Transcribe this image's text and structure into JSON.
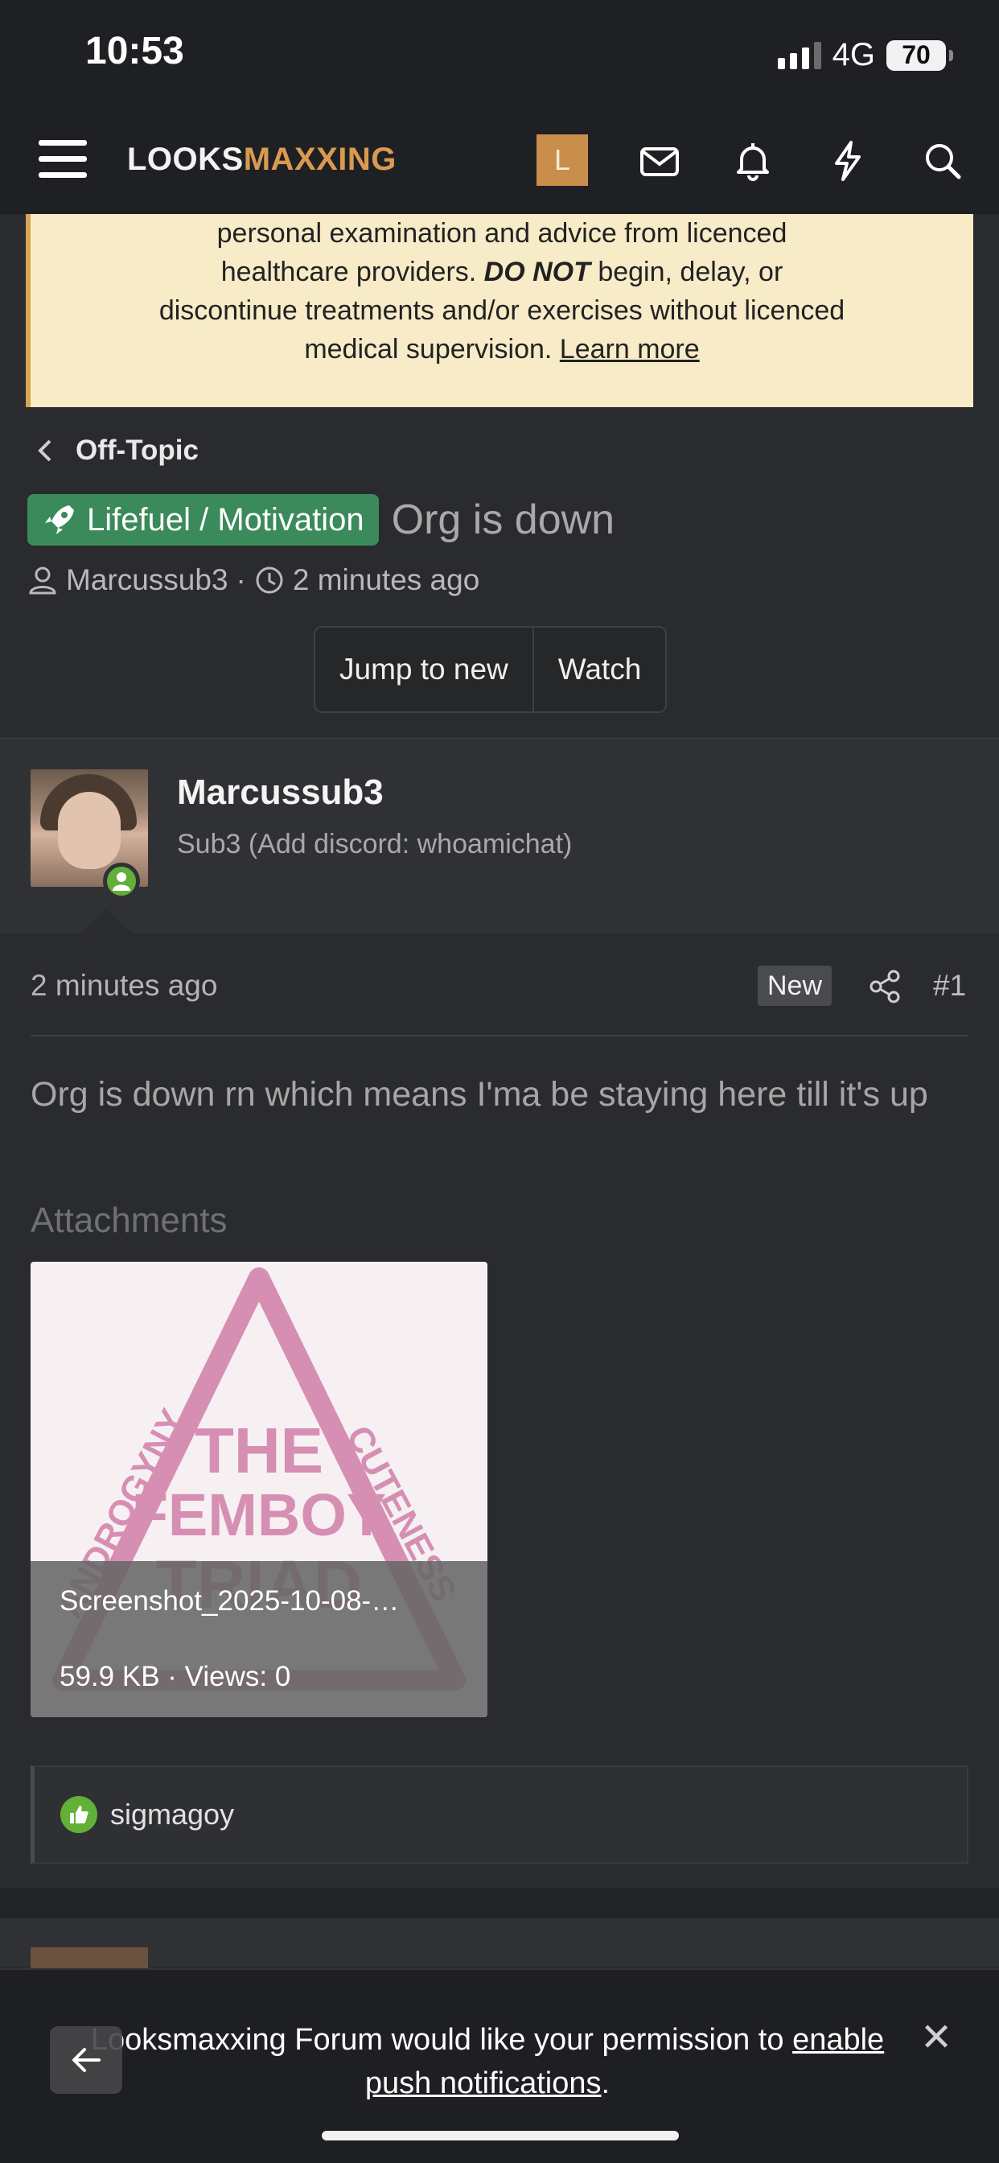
{
  "status_bar": {
    "time": "10:53",
    "network": "4G",
    "battery": "70"
  },
  "header": {
    "logo_part1": "LOOKS",
    "logo_part2": "MAXXING",
    "avatar_letter": "L",
    "icons": [
      "menu-icon",
      "inbox-icon",
      "bell-icon",
      "bolt-icon",
      "search-icon"
    ]
  },
  "notice": {
    "line1": "personal examination and advice from licenced",
    "line2_pre": "healthcare providers. ",
    "line2_bold": "DO NOT",
    "line2_post": " begin, delay, or",
    "line3": "discontinue treatments and/or exercises without licenced",
    "line4_pre": "medical supervision. ",
    "learn_more": "Learn more"
  },
  "breadcrumb": {
    "label": "Off-Topic"
  },
  "thread": {
    "prefix_tag": "Lifefuel / Motivation",
    "title": "Org is down",
    "author": "Marcussub3",
    "time": "2 minutes ago",
    "jump_label": "Jump to new",
    "watch_label": "Watch"
  },
  "post": {
    "username": "Marcussub3",
    "user_title": "Sub3 (Add discord: whoamichat)",
    "time": "2 minutes ago",
    "new_badge": "New",
    "number": "#1",
    "text": "Org is down rn which means I'ma be staying here till it's up",
    "attachments_label": "Attachments",
    "attachment": {
      "name": "Screenshot_2025-10-08-…",
      "meta": "59.9 KB · Views: 0",
      "image_words": {
        "left": "ANDROGYNY",
        "right": "CUTENESS",
        "center1": "THE",
        "center2": "FEMBOY",
        "center3": "TRIAD"
      }
    },
    "reaction_user": "sigmagoy"
  },
  "push_banner": {
    "pre": "Looksmaxxing Forum would like your permission to ",
    "link": "enable push notifications",
    "post": ".",
    "close": "✕"
  },
  "colors": {
    "brand_accent": "#d89a50",
    "tag_green": "#3b8a5c",
    "online_green": "#63b039",
    "notice_bg": "#f7ebc8"
  }
}
